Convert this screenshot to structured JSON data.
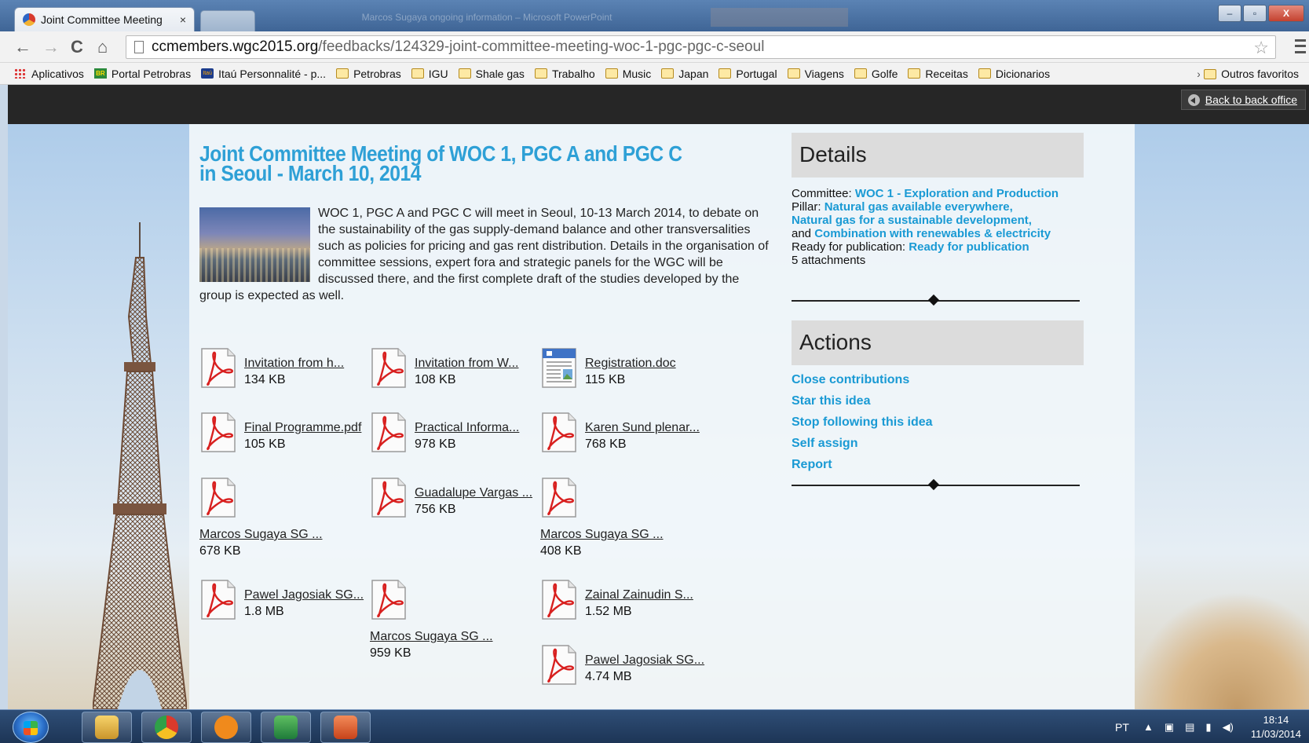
{
  "browser": {
    "tab_title": "Joint Committee Meeting",
    "tab_close": "×",
    "background_task_title": "Marcos Sugaya ongoing information – Microsoft PowerPoint",
    "url_host": "ccmembers.wgc2015.org",
    "url_path": "/feedbacks/124329-joint-committee-meeting-woc-1-pgc-pgc-c-seoul",
    "nav_back": "←",
    "nav_forward": "→",
    "nav_reload": "C",
    "nav_home": "⌂",
    "bookmark_star": "☆",
    "window_buttons": {
      "minimize": "–",
      "maximize": "▫",
      "close": "X"
    }
  },
  "bookmarks": {
    "items": [
      {
        "label": "Aplicativos",
        "icon": "apps-grid-icon"
      },
      {
        "label": "Portal Petrobras",
        "icon": "petrobras-icon"
      },
      {
        "label": "Itaú Personnalité - p...",
        "icon": "itau-icon"
      },
      {
        "label": "Petrobras",
        "icon": "folder-icon"
      },
      {
        "label": "IGU",
        "icon": "folder-icon"
      },
      {
        "label": "Shale gas",
        "icon": "folder-icon"
      },
      {
        "label": "Trabalho",
        "icon": "folder-icon"
      },
      {
        "label": "Music",
        "icon": "folder-icon"
      },
      {
        "label": "Japan",
        "icon": "folder-icon"
      },
      {
        "label": "Portugal",
        "icon": "folder-icon"
      },
      {
        "label": "Viagens",
        "icon": "folder-icon"
      },
      {
        "label": "Golfe",
        "icon": "folder-icon"
      },
      {
        "label": "Receitas",
        "icon": "folder-icon"
      },
      {
        "label": "Dicionarios",
        "icon": "folder-icon"
      }
    ],
    "overflow": "»",
    "other": "Outros favoritos"
  },
  "page": {
    "back_to_back_office": "Back to back office",
    "title": "Joint Committee Meeting of WOC 1, PGC A and PGC C in Seoul - March 10, 2014",
    "intro": "WOC 1, PGC A and PGC C will meet in Seoul, 10-13 March 2014, to debate on the sustainability of the gas supply-demand balance and other transversalities such as policies for pricing and gas rent distribution. Details in the organisation of committee sessions, expert fora and strategic panels for the WGC will be discussed there, and the first complete draft of the studies developed by the group is expected as well.",
    "attachments": [
      {
        "name": "Invitation from h...",
        "size": "134 KB",
        "type": "pdf"
      },
      {
        "name": "Invitation from W...",
        "size": "108 KB",
        "type": "pdf"
      },
      {
        "name": "Registration.doc",
        "size": "115 KB",
        "type": "doc"
      },
      {
        "name": "Final Programme.pdf",
        "size": "105 KB",
        "type": "pdf"
      },
      {
        "name": "Practical Informa...",
        "size": "978 KB",
        "type": "pdf"
      },
      {
        "name": "Karen Sund plenar...",
        "size": "768 KB",
        "type": "pdf"
      },
      {
        "name": "Marcos Sugaya SG ...",
        "size": "678 KB",
        "type": "pdf"
      },
      {
        "name": "Guadalupe Vargas ...",
        "size": "756 KB",
        "type": "pdf"
      },
      {
        "name": "Marcos Sugaya SG ...",
        "size": "408 KB",
        "type": "pdf"
      },
      {
        "name": "Pawel Jagosiak SG...",
        "size": "1.8 MB",
        "type": "pdf"
      },
      {
        "name": "Marcos Sugaya SG ...",
        "size": "959 KB",
        "type": "pdf"
      },
      {
        "name": "Zainal Zainudin S...",
        "size": "1.52 MB",
        "type": "pdf"
      },
      {
        "name": "Pawel Jagosiak SG...",
        "size": "4.74 MB",
        "type": "pdf"
      }
    ]
  },
  "details": {
    "heading": "Details",
    "committee_label": "Committee:",
    "committee_value": "WOC 1 - Exploration and Production",
    "pillar_label": "Pillar:",
    "pillar_value1": "Natural gas available everywhere,",
    "pillar_value2": "Natural gas for a sustainable development,",
    "pillar_and": "and",
    "pillar_value3": "Combination with renewables & electricity",
    "ready_label": "Ready for publication:",
    "ready_value": "Ready for publication",
    "attachments_count": "5 attachments"
  },
  "actions": {
    "heading": "Actions",
    "items": [
      "Close contributions",
      "Star this idea",
      "Stop following this idea",
      "Self assign",
      "Report"
    ]
  },
  "taskbar": {
    "apps": [
      "explorer-icon",
      "chrome-icon",
      "itau-app-icon",
      "excel-icon",
      "powerpoint-icon"
    ],
    "language": "PT",
    "time": "18:14",
    "date": "11/03/2014"
  },
  "colors": {
    "accent_blue": "#1a9ad4",
    "title_blue": "#2ea0d6",
    "topbar": "#262626",
    "pdf_red": "#d8201f"
  }
}
